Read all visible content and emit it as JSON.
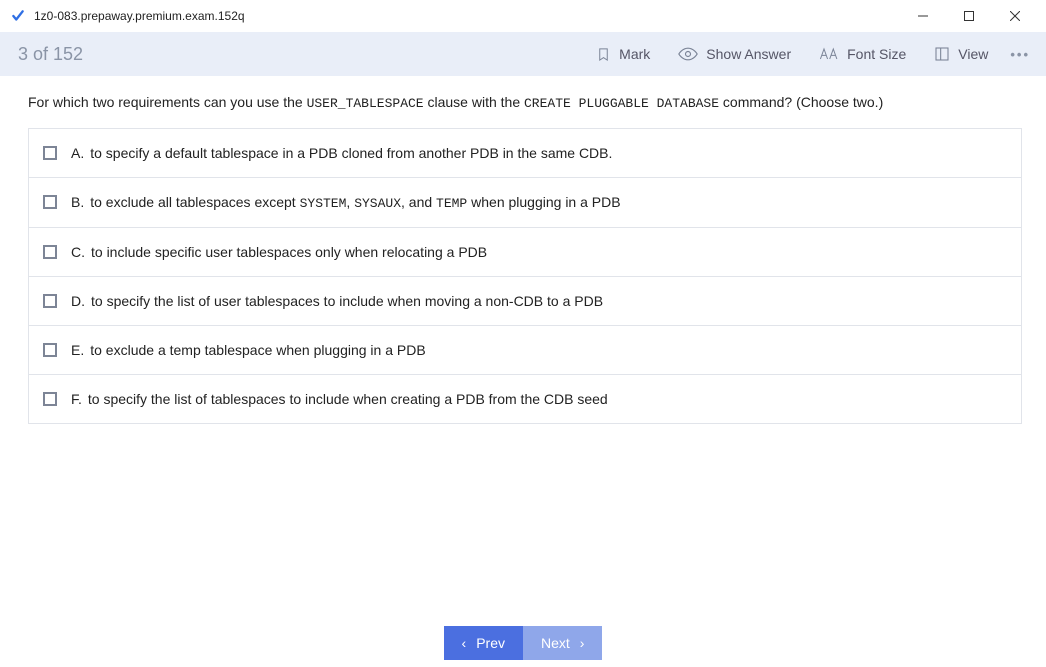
{
  "window": {
    "title": "1z0-083.prepaway.premium.exam.152q"
  },
  "toolbar": {
    "counter": "3 of 152",
    "mark": "Mark",
    "show_answer": "Show Answer",
    "font_size": "Font Size",
    "view": "View",
    "more": "•••"
  },
  "question": {
    "pre": "For which two requirements can you use the ",
    "code1": "USER_TABLESPACE",
    "mid1": " clause with the ",
    "code2": "CREATE PLUGGABLE DATABASE",
    "post": " command? (Choose two.)"
  },
  "options": [
    {
      "letter": "A.",
      "pre": "to specify a default tablespace in a PDB cloned from another PDB in the same CDB.",
      "codes": []
    },
    {
      "letter": "B.",
      "pre": "to exclude all tablespaces except ",
      "c1": "SYSTEM",
      "s1": ", ",
      "c2": "SYSAUX",
      "s2": ", and ",
      "c3": "TEMP",
      "post": " when plugging in a PDB"
    },
    {
      "letter": "C.",
      "pre": "to include specific user tablespaces only when relocating a PDB"
    },
    {
      "letter": "D.",
      "pre": "to specify the list of user tablespaces to include when moving a non-CDB to a PDB"
    },
    {
      "letter": "E.",
      "pre": "to exclude a temp tablespace when plugging in a PDB"
    },
    {
      "letter": "F.",
      "pre": "to specify the list of tablespaces to include when creating a PDB from the CDB seed"
    }
  ],
  "nav": {
    "prev": "Prev",
    "next": "Next"
  }
}
